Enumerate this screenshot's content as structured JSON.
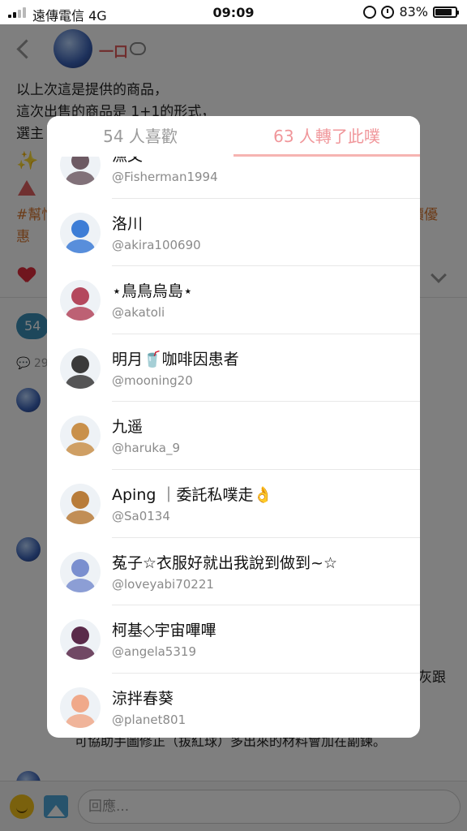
{
  "status_bar": {
    "carrier": "遠傳電信",
    "network": "4G",
    "time": "09:09",
    "battery": "83%",
    "battery_level": 0.83
  },
  "post": {
    "author": "一口",
    "lines": [
      "以上次這是提供的商品，",
      "這次出售的商品是 1+1的形式，",
      "選主"
    ],
    "tag_text": "#幫忙",
    "tag_text_tail": "價優",
    "tag_line2": "惠",
    "badge_count": "54",
    "comment_count": "29",
    "resp_text_1": "灰跟",
    "resp_text_2": "可協助手圖修正（拔紅球）多出來的材料會加在副鍊。"
  },
  "reply": {
    "placeholder": "回應..."
  },
  "modal": {
    "tabs": [
      {
        "label": "54 人喜歡",
        "active": false
      },
      {
        "label": "63 人轉了此噗",
        "active": true
      }
    ],
    "users": [
      {
        "name": "漁父",
        "handle": "@Fisherman1994",
        "avatar_color": "#6d5a63"
      },
      {
        "name": "洛川",
        "handle": "@akira100690",
        "avatar_color": "#3d7dd6"
      },
      {
        "name": "⋆鳥鳥烏島⋆",
        "handle": "@akatoli",
        "avatar_color": "#b4485d"
      },
      {
        "name": "明月🥤咖啡因患者",
        "handle": "@mooning20",
        "avatar_color": "#3a3a3a"
      },
      {
        "name": "九遥",
        "handle": "@haruka_9",
        "avatar_color": "#c9904a"
      },
      {
        "name": "Aping ｜委託私噗走👌",
        "handle": "@Sa0134",
        "avatar_color": "#b87c3a"
      },
      {
        "name": "菟子☆衣服好就出我說到做到~☆",
        "handle": "@loveyabi70221",
        "avatar_color": "#7a8fcf"
      },
      {
        "name": "柯基◇宇宙嗶嗶",
        "handle": "@angela5319",
        "avatar_color": "#5a2a4a"
      },
      {
        "name": "涼拌春葵",
        "handle": "@planet801",
        "avatar_color": "#f0a98a"
      }
    ]
  }
}
